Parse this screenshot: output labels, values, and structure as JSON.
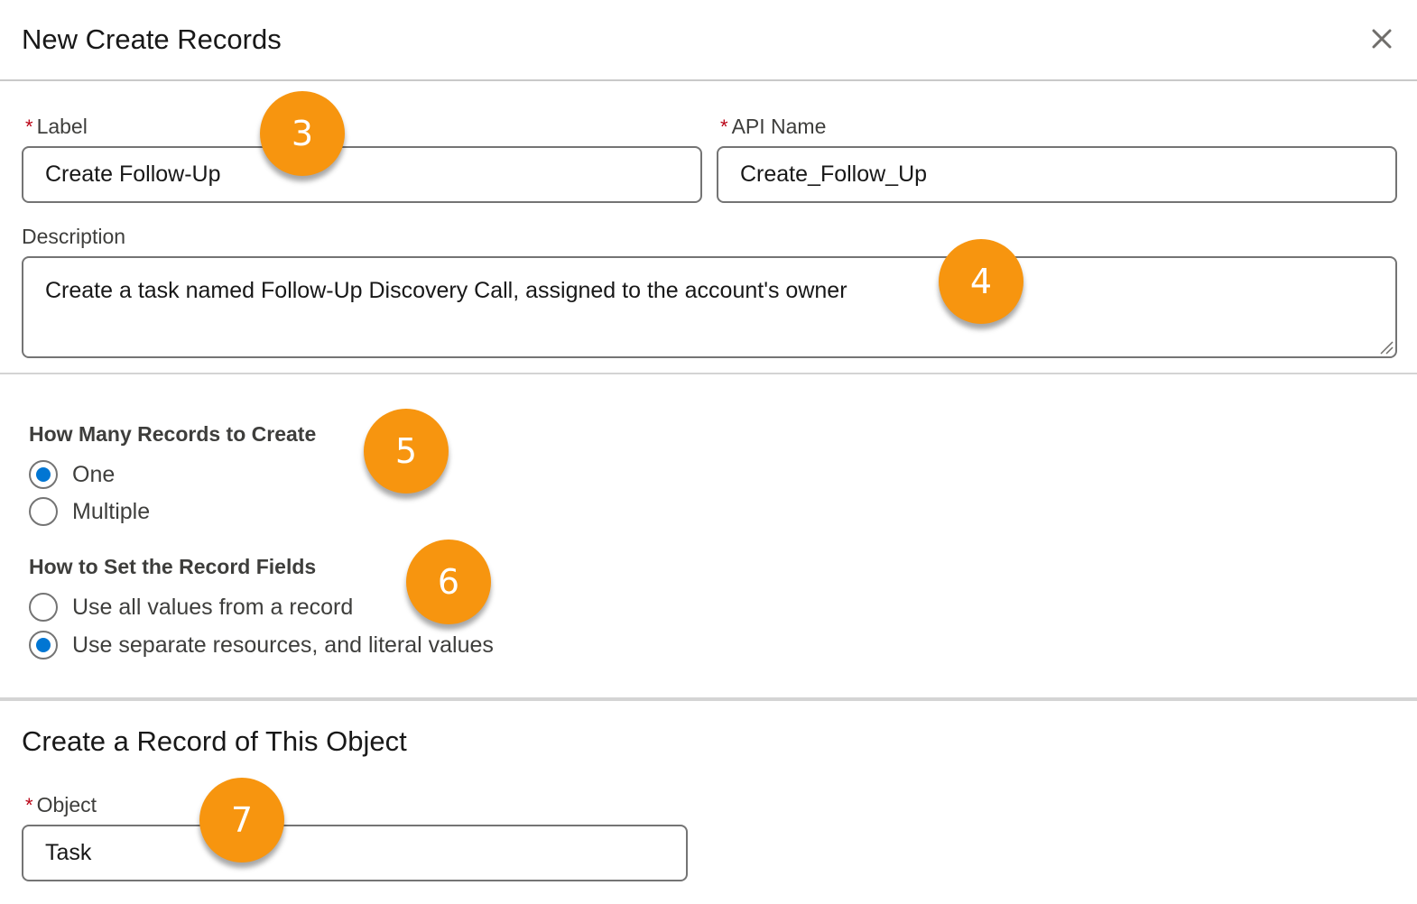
{
  "header": {
    "title": "New Create Records",
    "close_icon": "close-icon"
  },
  "fields": {
    "label": {
      "label": "Label",
      "required_mark": "*",
      "value": "Create Follow-Up"
    },
    "api_name": {
      "label": "API Name",
      "required_mark": "*",
      "value": "Create_Follow_Up"
    },
    "description": {
      "label": "Description",
      "value": "Create a task named Follow-Up Discovery Call, assigned to the account's owner"
    }
  },
  "how_many": {
    "legend": "How Many Records to Create",
    "options": [
      {
        "label": "One",
        "checked": true
      },
      {
        "label": "Multiple",
        "checked": false
      }
    ]
  },
  "how_to_set": {
    "legend": "How to Set the Record Fields",
    "options": [
      {
        "label": "Use all values from a record",
        "checked": false
      },
      {
        "label": "Use separate resources, and literal values",
        "checked": true
      }
    ]
  },
  "object_section": {
    "title": "Create a Record of This Object",
    "object": {
      "label": "Object",
      "required_mark": "*",
      "value": "Task"
    }
  },
  "callouts": [
    "3",
    "4",
    "5",
    "6",
    "7"
  ],
  "colors": {
    "accent": "#0176d3",
    "required": "#ba0517",
    "callout": "#f7950f"
  }
}
